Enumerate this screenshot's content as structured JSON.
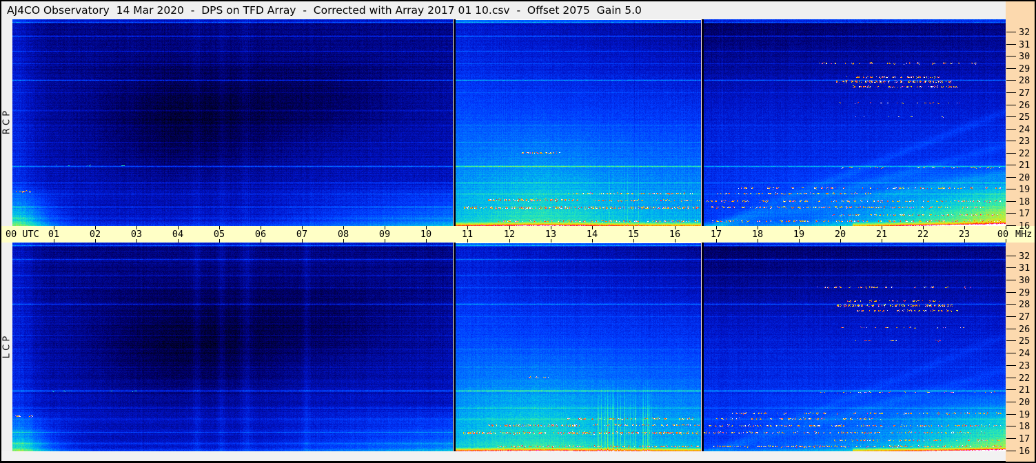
{
  "window": {
    "title": "AJ4CO Observatory  14 Mar 2020  -  DPS on TFD Array  -  Corrected with Array 2017 01 10.csv  -  Offset 2075  Gain 5.0"
  },
  "colors": {
    "titlebar_bg": "#f0f0f0",
    "axis_bg": "#ffffc6",
    "freq_scale_bg": "#fcd9ae",
    "border": "#000000",
    "bottom_strip_bg": "#f2f2f2"
  },
  "left_labels": {
    "top": "R C P",
    "bottom": "L C P"
  },
  "time_axis": {
    "left_label": "00 UTC",
    "hours": [
      "01",
      "02",
      "03",
      "04",
      "05",
      "06",
      "07",
      "08",
      "09",
      "10",
      "11",
      "12",
      "13",
      "14",
      "15",
      "16",
      "17",
      "18",
      "19",
      "20",
      "21",
      "22",
      "23"
    ],
    "right_label": "00",
    "unit": "MHz"
  },
  "freq_axis": {
    "ticks": [
      "32",
      "31",
      "30",
      "29",
      "28",
      "27",
      "26",
      "25",
      "24",
      "23",
      "22",
      "21",
      "20",
      "19",
      "18",
      "17",
      "16"
    ]
  },
  "chart_data": {
    "type": "heatmap",
    "title": "Dual-polarization 24-hour dynamic spectrum",
    "xlabel": "UTC",
    "ylabel": "MHz",
    "x_range": [
      0,
      24
    ],
    "y_range": [
      16,
      32
    ],
    "x_ticks": [
      "00",
      "01",
      "02",
      "03",
      "04",
      "05",
      "06",
      "07",
      "08",
      "09",
      "10",
      "11",
      "12",
      "13",
      "14",
      "15",
      "16",
      "17",
      "18",
      "19",
      "20",
      "21",
      "22",
      "23",
      "00"
    ],
    "y_ticks": [
      32,
      31,
      30,
      29,
      28,
      27,
      26,
      25,
      24,
      23,
      22,
      21,
      20,
      19,
      18,
      17,
      16
    ],
    "panels": [
      {
        "id": "rcp",
        "label": "R C P"
      },
      {
        "id": "lcp",
        "label": "L C P"
      }
    ],
    "gaps_utc": [
      10.655,
      16.655
    ],
    "features": [
      "Dark pre-dawn background minimum ~02:00-07:00 UTC at 20-29 MHz",
      "Bright cyan low-frequency patch near 00:00-01:00 UTC below 19 MHz",
      "Daytime teal/green ionospheric brightening 10:40-16:40 UTC, strongest below 20 MHz",
      "Heavy speckled shortwave-broadcast RFI bands at 16-18.5 MHz after 11:00 UTC",
      "Short speckled burst near 22 MHz around 12:20-13:15 UTC",
      "Dotted emission bands near 27.4-29.4 MHz between 19:30 and 23:00 UTC",
      "Bright cyan low-frequency wedge growing toward 24:00 UTC",
      "Vertical data-gap lines at ~10:39 and ~16:39 UTC",
      "Numerous persistent horizontal RFI carrier lines"
    ],
    "rfi_lines": [
      {
        "f": 32.8,
        "amp": 0.2
      },
      {
        "f": 31.7,
        "amp": 0.15
      },
      {
        "f": 30.4,
        "amp": 0.08
      },
      {
        "f": 29.4,
        "amp": 0.07
      },
      {
        "f": 28.0,
        "amp": 0.18
      },
      {
        "f": 27.0,
        "amp": 0.06
      },
      {
        "f": 25.5,
        "amp": 0.06,
        "t1": 10.65
      },
      {
        "f": 24.3,
        "amp": 0.05
      },
      {
        "f": 22.9,
        "amp": 0.05
      },
      {
        "f": 20.9,
        "amp": 0.2
      },
      {
        "f": 19.5,
        "amp": 0.09
      },
      {
        "f": 18.6,
        "amp": 0.07
      },
      {
        "f": 17.5,
        "amp": 0.1,
        "t1": 10.65
      },
      {
        "f": 16.6,
        "amp": 0.08,
        "t1": 10.65
      }
    ],
    "speckle_bands": [
      {
        "f": 29.4,
        "t0": 19.4,
        "t1": 23.3,
        "d": 0.3,
        "th": 1.5
      },
      {
        "f": 28.25,
        "t0": 20.15,
        "t1": 22.4,
        "d": 0.5,
        "th": 1.5
      },
      {
        "f": 27.9,
        "t0": 19.9,
        "t1": 22.75,
        "d": 0.85,
        "th": 3
      },
      {
        "f": 27.45,
        "t0": 20.3,
        "t1": 22.85,
        "d": 0.55,
        "th": 2
      },
      {
        "f": 26.1,
        "t0": 19.9,
        "t1": 23.0,
        "d": 0.18,
        "th": 1
      },
      {
        "f": 25.0,
        "t0": 20.3,
        "t1": 22.5,
        "d": 0.12,
        "th": 1
      },
      {
        "f": 22.0,
        "t0": 12.3,
        "t1": 13.25,
        "d": 0.8,
        "th": 2,
        "panels": "rcp"
      },
      {
        "f": 22.0,
        "t0": 12.45,
        "t1": 12.95,
        "d": 0.8,
        "th": 2,
        "panels": "lcp"
      },
      {
        "f": 20.75,
        "t0": 19.5,
        "t1": 23.9,
        "d": 0.2,
        "th": 1
      },
      {
        "f": 19.05,
        "t0": 17.3,
        "t1": 23.9,
        "d": 0.25,
        "th": 1.5
      },
      {
        "f": 18.6,
        "t0": 13.4,
        "t1": 16.5,
        "d": 0.4,
        "th": 1.5
      },
      {
        "f": 18.6,
        "t0": 17.0,
        "t1": 21.0,
        "d": 0.3,
        "th": 1.5
      },
      {
        "f": 18.05,
        "t0": 11.5,
        "t1": 13.7,
        "d": 0.85,
        "th": 2.5
      },
      {
        "f": 18.05,
        "t0": 13.9,
        "t1": 16.6,
        "d": 0.5,
        "th": 2
      },
      {
        "f": 18.0,
        "t0": 16.7,
        "t1": 23.9,
        "d": 0.45,
        "th": 2
      },
      {
        "f": 17.45,
        "t0": 10.9,
        "t1": 16.6,
        "d": 0.9,
        "th": 2.5
      },
      {
        "f": 17.45,
        "t0": 16.7,
        "t1": 23.5,
        "d": 0.55,
        "th": 2
      },
      {
        "f": 16.85,
        "t0": 19.8,
        "t1": 23.9,
        "d": 0.5,
        "th": 2
      },
      {
        "f": 16.35,
        "t0": 11.7,
        "t1": 16.6,
        "d": 0.7,
        "th": 2
      },
      {
        "f": 16.35,
        "t0": 16.9,
        "t1": 23.9,
        "d": 0.5,
        "th": 2
      },
      {
        "f": 18.8,
        "t0": 0.05,
        "t1": 0.5,
        "d": 0.5,
        "th": 1.5
      },
      {
        "f": 20.9,
        "t0": 0.8,
        "t1": 3.2,
        "d": 0.1,
        "th": 1,
        "low": true
      }
    ]
  }
}
